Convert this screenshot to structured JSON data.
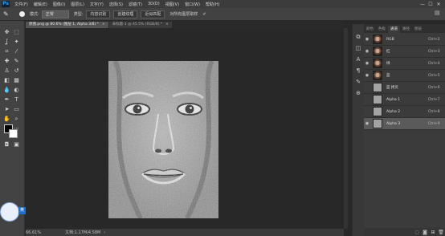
{
  "app": {
    "logo": "Ps"
  },
  "menu": [
    "文件(F)",
    "编辑(E)",
    "图像(I)",
    "图层(L)",
    "文字(Y)",
    "选择(S)",
    "滤镜(T)",
    "3D(D)",
    "视图(V)",
    "窗口(W)",
    "帮助(H)"
  ],
  "window_controls": {
    "minimize": "—",
    "maximize": "☐",
    "close": "✕"
  },
  "options_bar": {
    "mode_label": "模式:",
    "mode_value": "正常",
    "type_label": "类型:",
    "content_aware": "内容识别",
    "create_texture": "创建纹理",
    "proximity_match": "近似匹配",
    "sample_all_layers": "对所有图层取样"
  },
  "tabs": [
    {
      "label": "原图.png @ 80.6% (图层 1, Alpha 3/8) *",
      "close": "×"
    },
    {
      "label": "未标题-1 @ 45.5% (RGB/8) *",
      "close": "×"
    }
  ],
  "status": {
    "zoom": "66.61%",
    "doc": "文档:1.17M/4.58M",
    "arrow": "›"
  },
  "panel": {
    "tabs": [
      "颜色",
      "色板",
      "通道",
      "路径",
      "图层"
    ],
    "active_tab": "通道",
    "channels": [
      {
        "name": "RGB",
        "shortcut": "Ctrl+2",
        "thumb": "face",
        "visible": true
      },
      {
        "name": "红",
        "shortcut": "Ctrl+3",
        "thumb": "face",
        "visible": true
      },
      {
        "name": "绿",
        "shortcut": "Ctrl+4",
        "thumb": "face",
        "visible": true
      },
      {
        "name": "蓝",
        "shortcut": "Ctrl+5",
        "thumb": "face",
        "visible": true
      },
      {
        "name": "蓝 拷贝",
        "shortcut": "Ctrl+6",
        "thumb": "gray",
        "visible": false
      },
      {
        "name": "Alpha 1",
        "shortcut": "Ctrl+7",
        "thumb": "gray",
        "visible": false
      },
      {
        "name": "Alpha 2",
        "shortcut": "Ctrl+8",
        "thumb": "gray",
        "visible": false
      },
      {
        "name": "Alpha 3",
        "shortcut": "Ctrl+9",
        "thumb": "gray",
        "visible": true,
        "selected": true
      }
    ]
  },
  "widget": {
    "label": "英"
  }
}
